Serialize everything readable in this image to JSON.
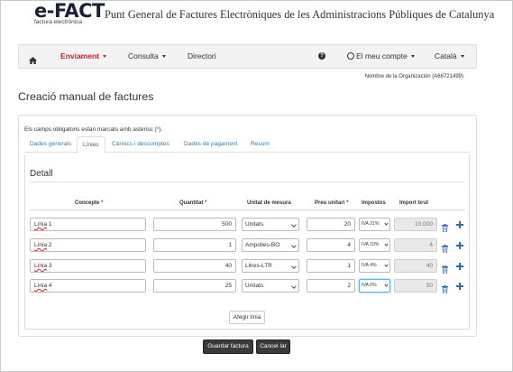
{
  "header": {
    "logo_text": "e-FACT",
    "logo_subtitle": "factura electrònica",
    "portal_title": "Punt General de Factures Electròniques de les Administracions Públiques de Catalunya"
  },
  "navbar": {
    "home_icon": "home-icon",
    "items": [
      {
        "label": "Enviament",
        "active": true
      },
      {
        "label": "Consulta"
      },
      {
        "label": "Directori"
      }
    ],
    "help_icon": "question-circle-icon",
    "account_label": "El meu compte",
    "language_label": "Català"
  },
  "organization_name": "Nombre de la Organización (A66721499)",
  "page_title": "Creació manual de factures",
  "required_note": "Els camps obligatoris estan marcats amb asterisc (",
  "required_note_star": "*",
  "required_note_end": ").",
  "tabs": [
    {
      "label": "Dades generals"
    },
    {
      "label": "Línies",
      "active": true
    },
    {
      "label": "Càrrecs i descomptes"
    },
    {
      "label": "Dades de pagament"
    },
    {
      "label": "Resum"
    }
  ],
  "detail": {
    "title": "Detall",
    "columns": {
      "concept": "Concepte",
      "quantity": "Quantitat",
      "unit": "Unitat de mesura",
      "unit_price": "Preu unitari",
      "taxes": "Impostos",
      "gross_amount": "Import brut",
      "required_mark": "*"
    },
    "rows": [
      {
        "concept_word": "Línia",
        "concept_num": " 1",
        "quantity": "500",
        "unit": "Unitats",
        "unit_price": "20",
        "tax": "IVA 21%",
        "gross": "10.000"
      },
      {
        "concept_word": "Línia",
        "concept_num": " 2",
        "quantity": "1",
        "unit": "Ampolles-BO",
        "unit_price": "4",
        "tax": "IVA 10%",
        "gross": "4"
      },
      {
        "concept_word": "Línia",
        "concept_num": " 3",
        "quantity": "40",
        "unit": "Litres-LTR",
        "unit_price": "1",
        "tax": "IVA 4%",
        "gross": "40"
      },
      {
        "concept_word": "Línia",
        "concept_num": " 4",
        "quantity": "25",
        "unit": "Unitats",
        "unit_price": "2",
        "tax": "IVA 0%",
        "gross": "50"
      }
    ],
    "add_line_label": "Afegir línia"
  },
  "actions": {
    "save_label": "Guardar factura",
    "cancel_label": "Cancel·lar"
  },
  "colors": {
    "brand_red": "#c9202a",
    "link_blue": "#337ab7",
    "icon_blue": "#2c6bb4"
  }
}
